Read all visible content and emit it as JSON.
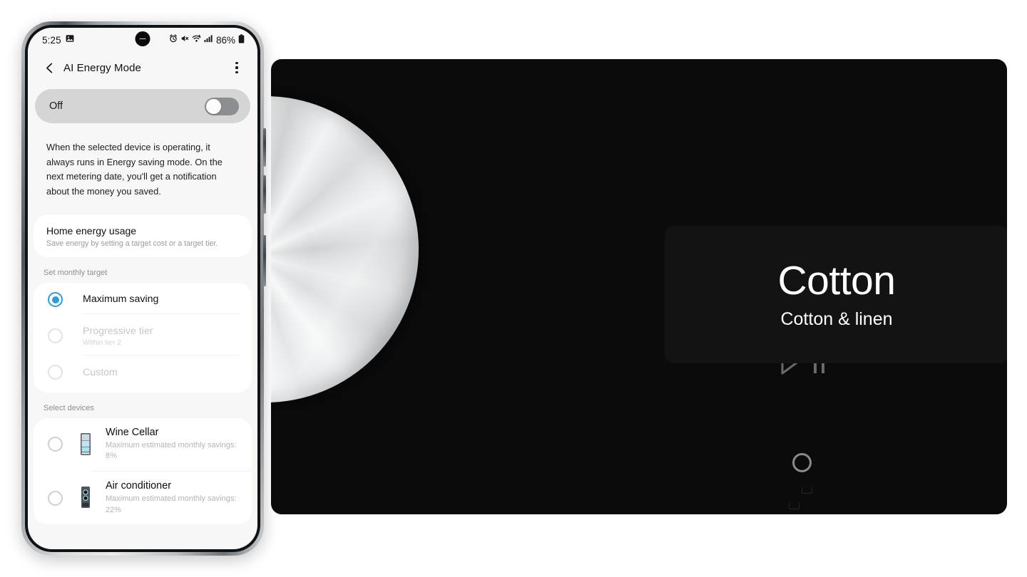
{
  "phone": {
    "status_bar": {
      "time": "5:25",
      "icons_left": [
        "gallery-icon"
      ],
      "icons_right": [
        "alarm-icon",
        "mute-icon",
        "wifi-icon",
        "signal-icon"
      ],
      "battery_percent": "86%",
      "battery_icon": "battery-icon",
      "camera": "punch-hole-camera"
    },
    "app_bar": {
      "back_icon": "back-chevron-icon",
      "title": "AI Energy Mode",
      "more_icon": "more-options-icon"
    },
    "master_toggle": {
      "label": "Off",
      "state": "off"
    },
    "description": "When the selected device is operating, it always runs in Energy saving mode. On the next metering date, you'll get a notification about the money you saved.",
    "home_energy": {
      "title": "Home energy usage",
      "subtitle": "Save energy by setting a target cost or a target tier."
    },
    "monthly_target": {
      "section_label": "Set monthly target",
      "options": [
        {
          "label": "Maximum saving",
          "sub": "",
          "selected": true,
          "disabled": false
        },
        {
          "label": "Progressive tier",
          "sub": "Within tier 2",
          "selected": false,
          "disabled": true
        },
        {
          "label": "Custom",
          "sub": "",
          "selected": false,
          "disabled": true
        }
      ]
    },
    "select_devices": {
      "section_label": "Select devices",
      "devices": [
        {
          "name": "Wine Cellar",
          "sub": "Maximum estimated monthly savings: 8%",
          "icon": "wine-cellar-icon",
          "selected": false
        },
        {
          "name": "Air conditioner",
          "sub": "Maximum estimated monthly savings: 22%",
          "icon": "air-conditioner-icon",
          "selected": false
        }
      ]
    },
    "side_buttons": [
      "volume-up-button",
      "volume-down-button",
      "power-button"
    ]
  },
  "washer": {
    "dial": "control-dial",
    "play_pause_icon": "play-pause-icon",
    "cycle": {
      "name": "Cotton",
      "description": "Cotton & linen"
    },
    "power_button_icon": "power-ring-icon",
    "indicator_marks": "status-indicator-marks"
  },
  "colors": {
    "accent_blue": "#2a9ddb",
    "panel_black": "#0b0b0b",
    "card_black": "#131313",
    "toggle_off_track": "#8c8f91",
    "phone_screen_bg": "#f7f7f7"
  }
}
